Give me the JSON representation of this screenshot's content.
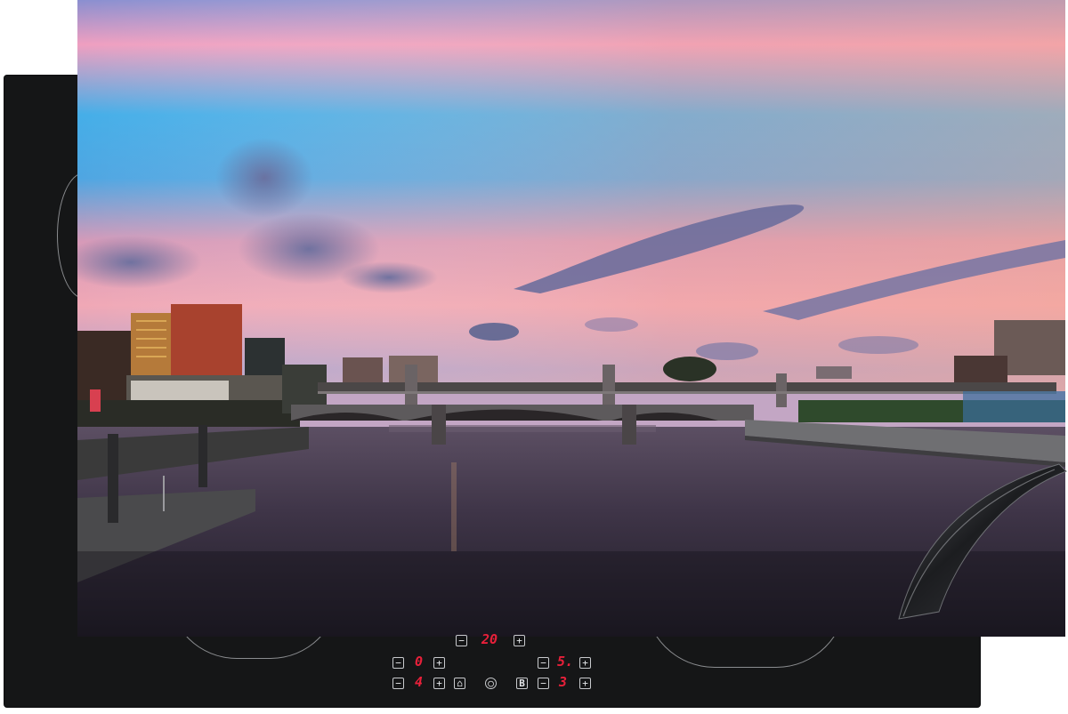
{
  "product": {
    "type": "induction-cooktop-protector-mat",
    "background_color": "#ffffff"
  },
  "cooktop": {
    "color": "#151617",
    "zone_outline_color": "#8a8c8f",
    "controls": {
      "top_row_display": "20",
      "left_zone_top": "0",
      "left_zone_bottom": "4",
      "right_zone_top": "5.",
      "right_zone_bottom": "3",
      "digit_color": "#e8203a",
      "icons": [
        "minus-icon",
        "plus-icon",
        "lock-icon",
        "power-icon",
        "boost-icon"
      ]
    }
  },
  "photo": {
    "scene": "river-bridge-at-sunset",
    "colors": {
      "sky_top": "#8a8fd0",
      "sky_blue": "#3fa9e6",
      "sky_pink": "#f3a0b5",
      "horizon": "#e9a2b0",
      "water": "#3b3346",
      "buildings": "#2a2426"
    }
  }
}
